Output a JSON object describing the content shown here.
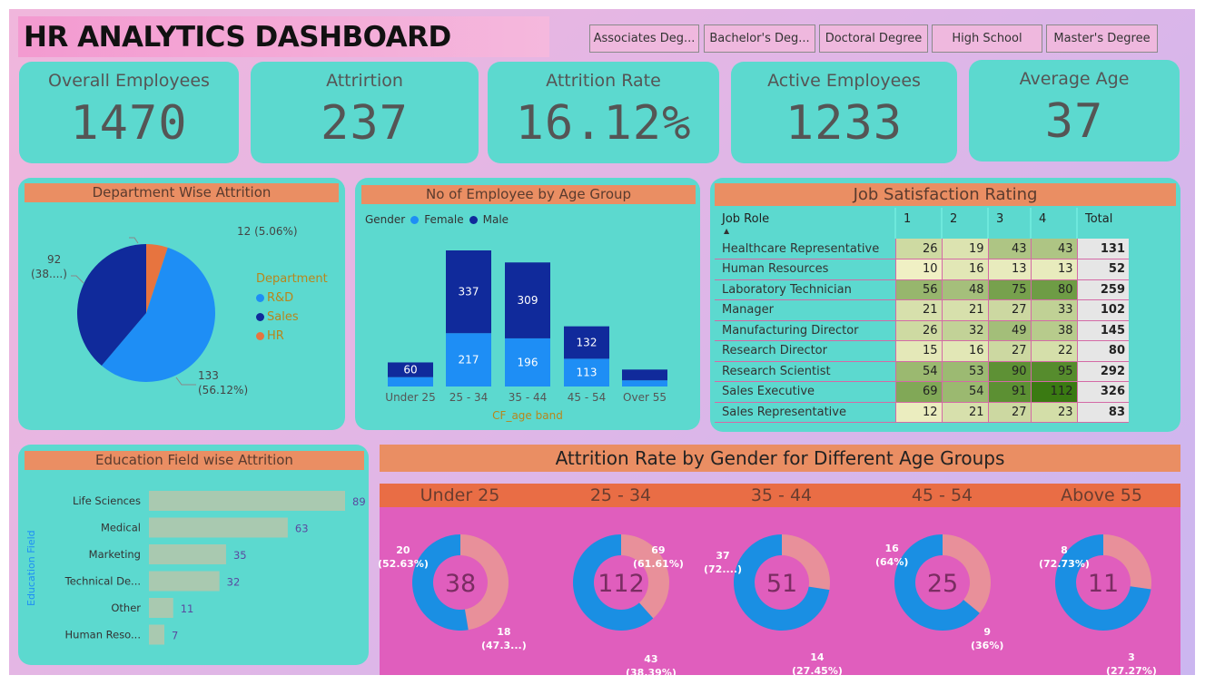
{
  "title": "HR ANALYTICS DASHBOARD",
  "slicers": [
    "Associates Deg...",
    "Bachelor's Deg...",
    "Doctoral Degree",
    "High School",
    "Master's Degree"
  ],
  "kpis": [
    {
      "label": "Overall Employees",
      "value": "1470"
    },
    {
      "label": "Attrirtion",
      "value": "237"
    },
    {
      "label": "Attrition Rate",
      "value": "16.12%"
    },
    {
      "label": "Active Employees",
      "value": "1233"
    },
    {
      "label": "Average Age",
      "value": "37"
    }
  ],
  "department": {
    "title": "Department Wise Attrition",
    "legend_title": "Department",
    "legend": [
      {
        "name": "R&D",
        "color": "#1e8ef5"
      },
      {
        "name": "Sales",
        "color": "#102a9b"
      },
      {
        "name": "HR",
        "color": "#e7743f"
      }
    ],
    "labels": {
      "hr": "12 (5.06%)",
      "sales_1": "92",
      "sales_2": "(38....)",
      "rd_1": "133",
      "rd_2": "(56.12%)"
    },
    "chart_data": {
      "type": "pie",
      "categories": [
        "R&D",
        "Sales",
        "HR"
      ],
      "values": [
        133,
        92,
        12
      ],
      "percent": [
        56.12,
        38.82,
        5.06
      ]
    }
  },
  "age_group": {
    "title": "No of Employee by Age Group",
    "legend_title": "Gender",
    "legend": [
      {
        "name": "Female",
        "color": "#1e8ef5"
      },
      {
        "name": "Male",
        "color": "#102a9b"
      }
    ],
    "xlabel": "CF_age band",
    "chart_data": {
      "type": "bar",
      "stacked": true,
      "categories": [
        "Under 25",
        "25 - 34",
        "35 - 44",
        "45 - 54",
        "Over 55"
      ],
      "series": [
        {
          "name": "Female",
          "values": [
            38,
            217,
            196,
            113,
            25
          ]
        },
        {
          "name": "Male",
          "values": [
            60,
            337,
            309,
            132,
            44
          ]
        }
      ],
      "data_labels": [
        [
          "",
          "60"
        ],
        [
          "217",
          "337"
        ],
        [
          "196",
          "309"
        ],
        [
          "113",
          "132"
        ],
        [
          "",
          ""
        ]
      ]
    }
  },
  "job_satisfaction": {
    "title": "Job Satisfaction Rating",
    "columns": [
      "Job Role",
      "1",
      "2",
      "3",
      "4",
      "Total"
    ],
    "rows": [
      {
        "role": "Healthcare Representative",
        "v": [
          "26",
          "19",
          "43",
          "43"
        ],
        "total": "131"
      },
      {
        "role": "Human Resources",
        "v": [
          "10",
          "16",
          "13",
          "13"
        ],
        "total": "52"
      },
      {
        "role": "Laboratory Technician",
        "v": [
          "56",
          "48",
          "75",
          "80"
        ],
        "total": "259"
      },
      {
        "role": "Manager",
        "v": [
          "21",
          "21",
          "27",
          "33"
        ],
        "total": "102"
      },
      {
        "role": "Manufacturing Director",
        "v": [
          "26",
          "32",
          "49",
          "38"
        ],
        "total": "145"
      },
      {
        "role": "Research Director",
        "v": [
          "15",
          "16",
          "27",
          "22"
        ],
        "total": "80"
      },
      {
        "role": "Research Scientist",
        "v": [
          "54",
          "53",
          "90",
          "95"
        ],
        "total": "292"
      },
      {
        "role": "Sales Executive",
        "v": [
          "69",
          "54",
          "91",
          "112"
        ],
        "total": "326"
      },
      {
        "role": "Sales Representative",
        "v": [
          "12",
          "21",
          "27",
          "23"
        ],
        "total": "83"
      }
    ]
  },
  "education": {
    "title": "Education Field wise Attrition",
    "ylabel": "Education Field",
    "chart_data": {
      "type": "bar",
      "orientation": "horizontal",
      "categories": [
        "Life Sciences",
        "Medical",
        "Marketing",
        "Technical De...",
        "Other",
        "Human Reso..."
      ],
      "values": [
        89,
        63,
        35,
        32,
        11,
        7
      ]
    }
  },
  "gender_age": {
    "title": "Attrition Rate by Gender for Different Age Groups",
    "chart_data": [
      {
        "type": "pie",
        "donut": true,
        "group": "Under 25",
        "total": "38",
        "values": [
          20,
          18
        ],
        "labels": [
          "20\n(52.63%)",
          "18\n(47.3...)"
        ]
      },
      {
        "type": "pie",
        "donut": true,
        "group": "25 - 34",
        "total": "112",
        "values": [
          69,
          43
        ],
        "labels": [
          "69\n(61.61%)",
          "43\n(38.39%)"
        ]
      },
      {
        "type": "pie",
        "donut": true,
        "group": "35 - 44",
        "total": "51",
        "values": [
          37,
          14
        ],
        "labels": [
          "37\n(72....)",
          "14\n(27.45%)"
        ]
      },
      {
        "type": "pie",
        "donut": true,
        "group": "45 - 54",
        "total": "25",
        "values": [
          16,
          9
        ],
        "labels": [
          "16\n(64%)",
          "9\n(36%)"
        ]
      },
      {
        "type": "pie",
        "donut": true,
        "group": "Above 55",
        "total": "11",
        "values": [
          8,
          3
        ],
        "labels": [
          "8\n(72.73%)",
          "3\n(27.27%)"
        ]
      }
    ],
    "colors": {
      "first": "#1a8fe3",
      "second": "#e8909a"
    }
  }
}
